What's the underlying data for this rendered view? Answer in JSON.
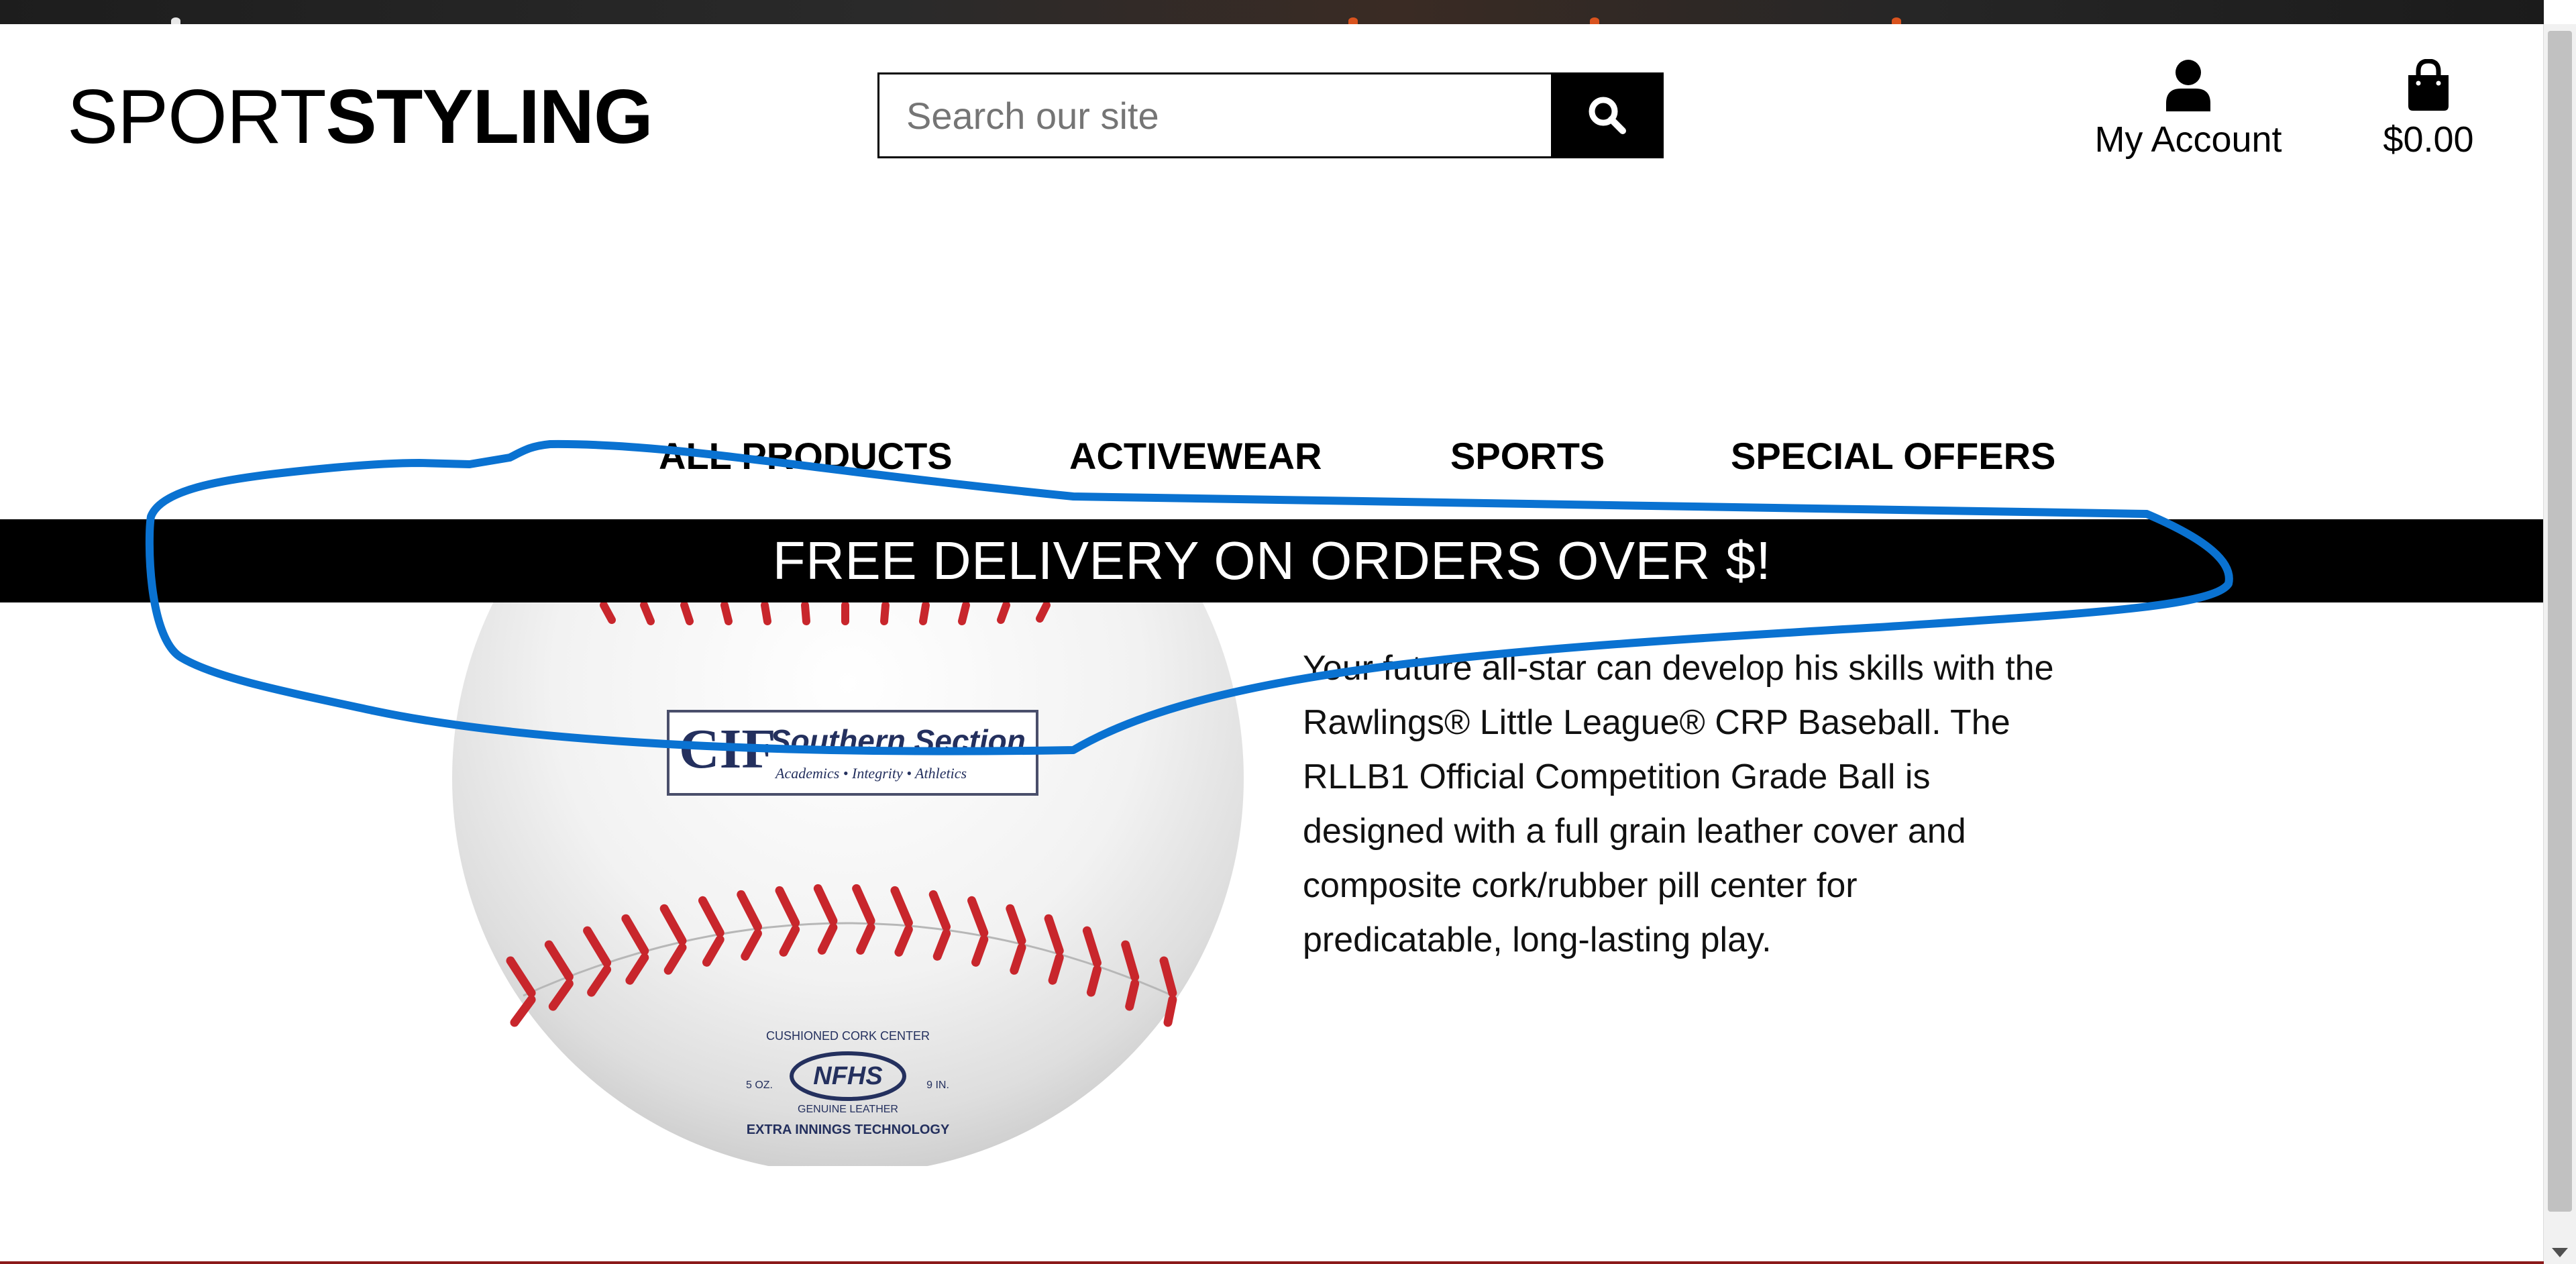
{
  "brand": {
    "light": "SPORT",
    "bold": "STYLING"
  },
  "search": {
    "placeholder": "Search our site",
    "icon": "search-icon"
  },
  "account": {
    "label": "My Account",
    "icon": "user-icon"
  },
  "cart": {
    "label": "$0.00",
    "icon": "shopping-bag-icon"
  },
  "nav": {
    "items": [
      {
        "label": "ALL PRODUCTS"
      },
      {
        "label": "ACTIVEWEAR"
      },
      {
        "label": "SPORTS"
      },
      {
        "label": "SPECIAL OFFERS"
      }
    ]
  },
  "banner": {
    "text": "FREE DELIVERY ON ORDERS OVER $!"
  },
  "product": {
    "image": {
      "section_title": "Southern Section",
      "section_motto": "Academics • Integrity • Athletics",
      "logo": "CIF",
      "stamp_top": "CUSHIONED CORK CENTER",
      "stamp_mark": "NFHS",
      "stamp_left": "5 OZ.",
      "stamp_right": "9 IN.",
      "stamp_bottom": "GENUINE LEATHER",
      "stamp_footer": "EXTRA INNINGS TECHNOLOGY"
    },
    "description_lines": [
      "Your future all-star can develop his skills with the",
      "Rawlings® Little League® CRP Baseball. The",
      "RLLB1 Official Competition Grade Ball is",
      "designed with a full grain leather cover and",
      "composite cork/rubber pill center for",
      "predicatable, long-lasting play."
    ]
  },
  "colors": {
    "banner_bg": "#000000",
    "banner_text": "#ffffff",
    "annotation": "#0a72d1",
    "stitch": "#c8262c"
  }
}
